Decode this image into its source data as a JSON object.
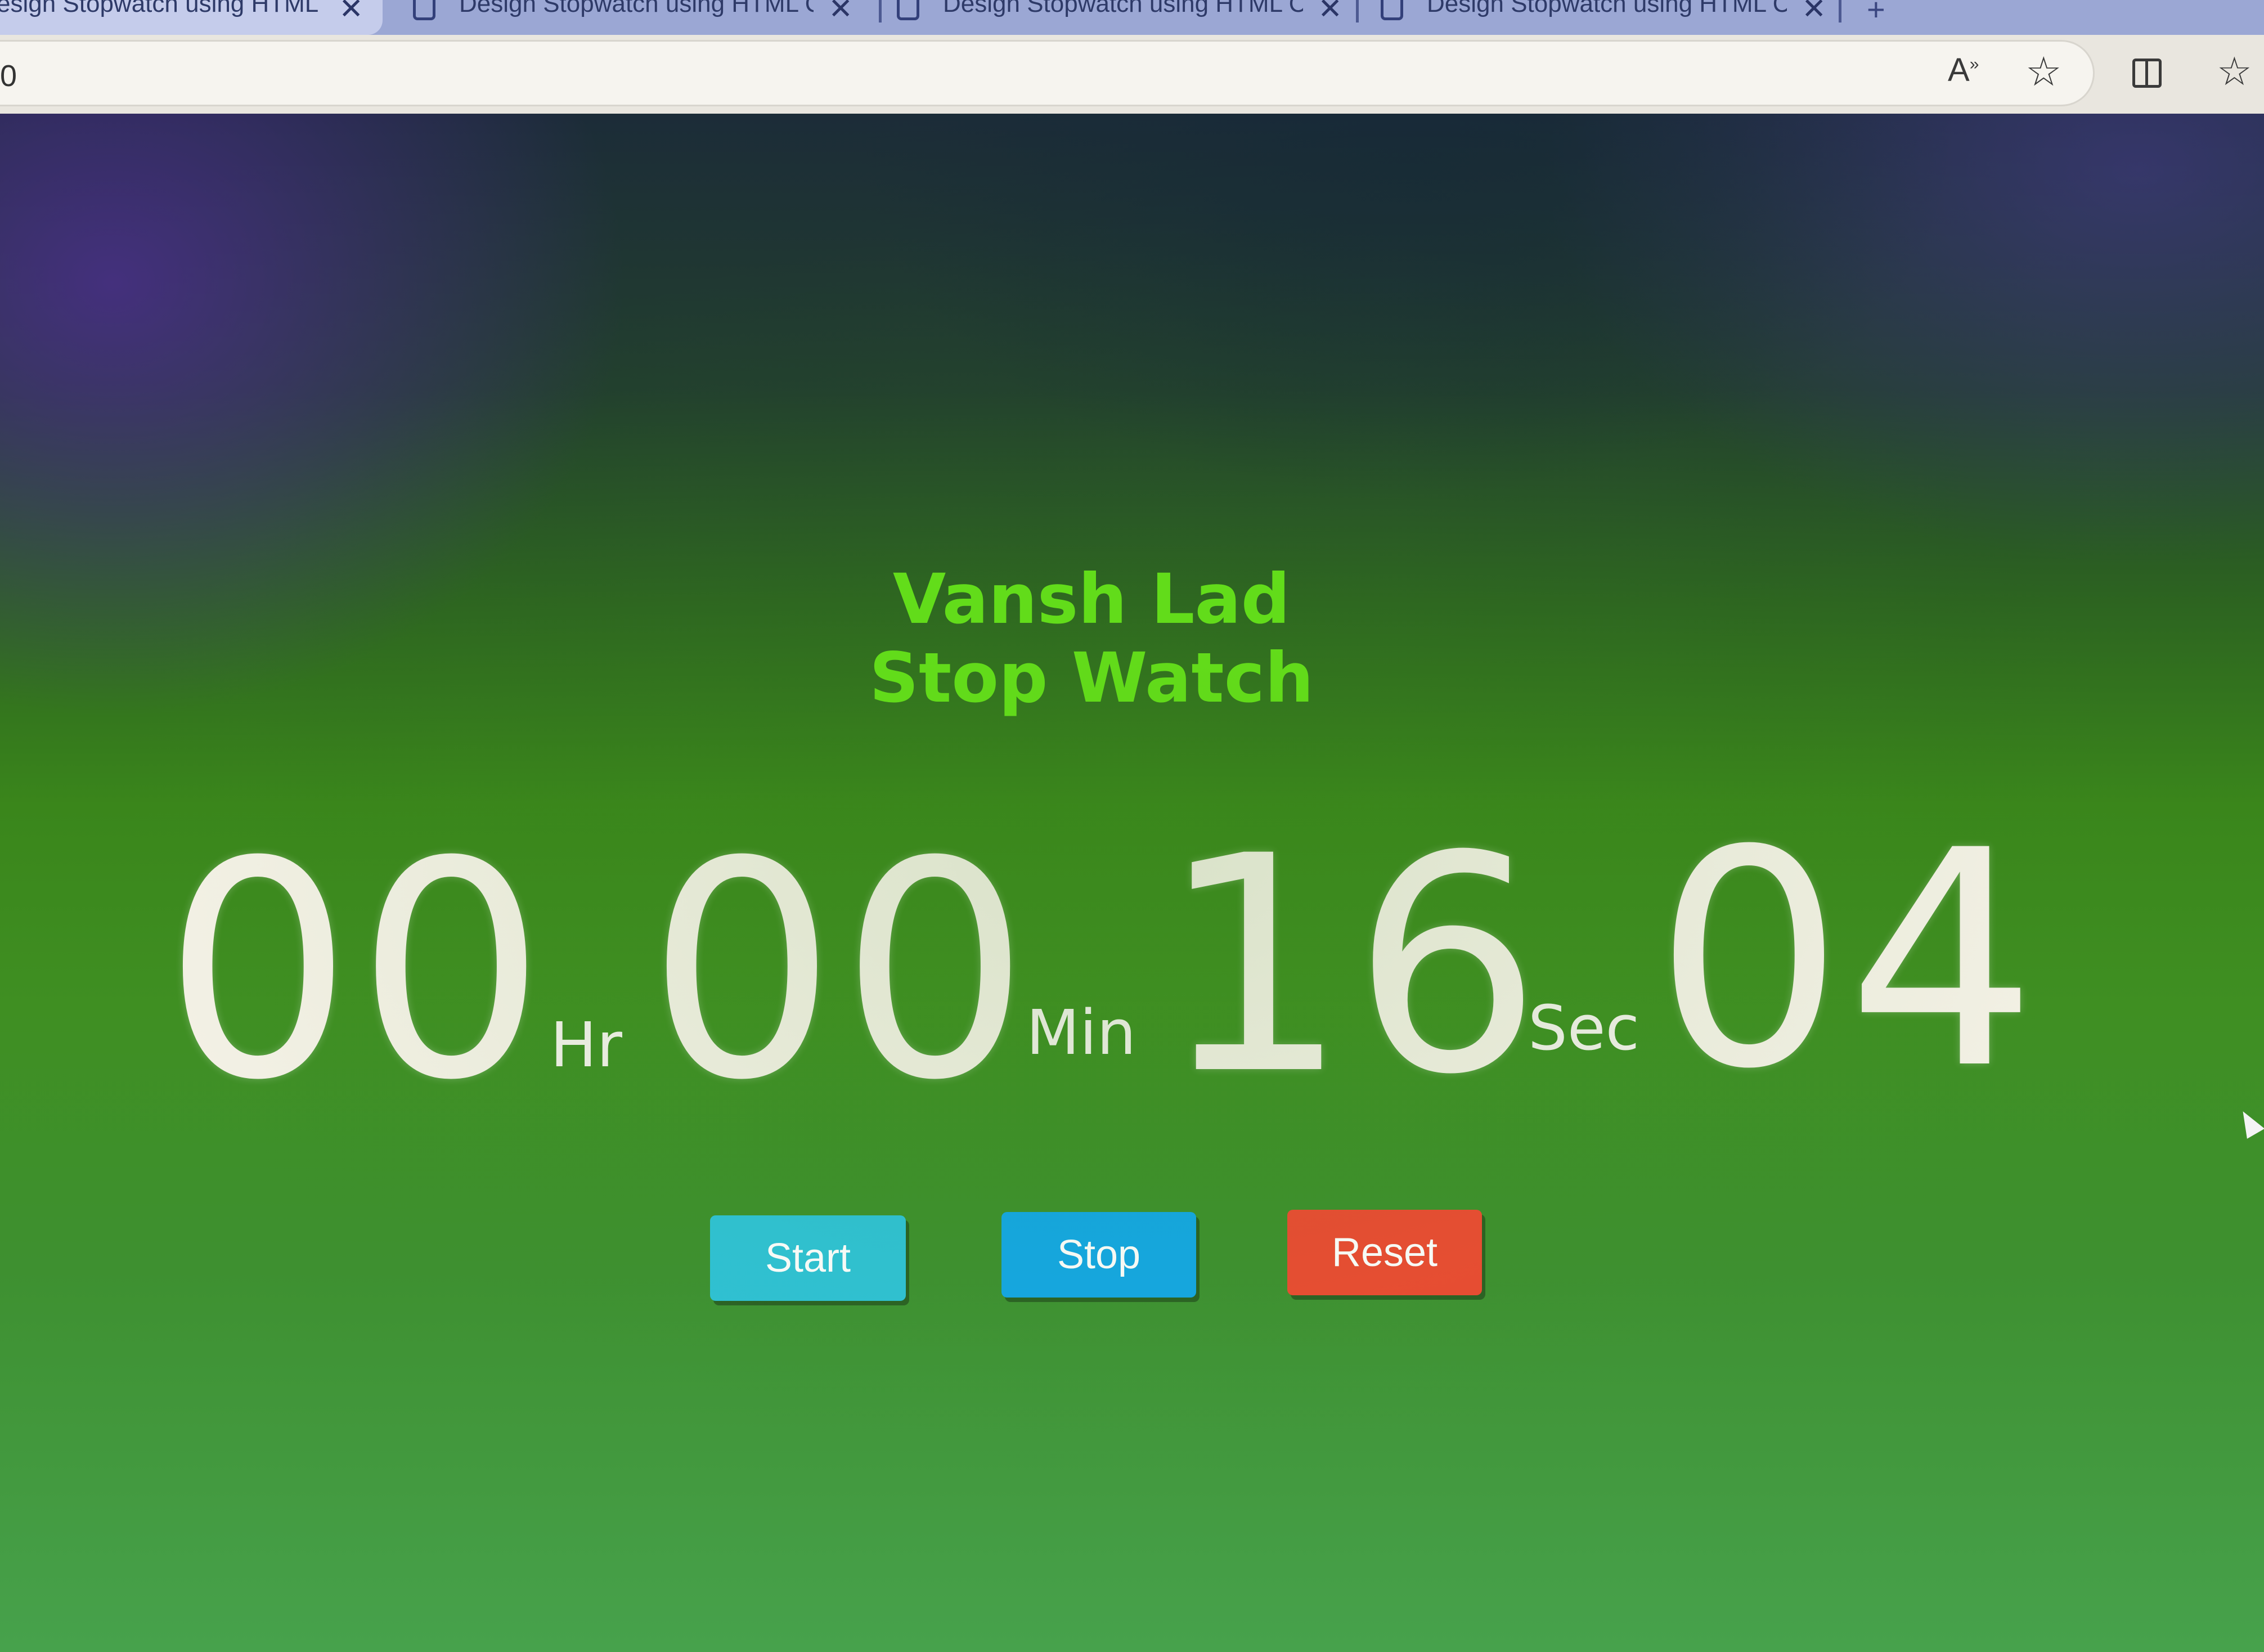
{
  "browser": {
    "tabs": [
      {
        "title": "esign Stopwatch using HTML C",
        "active": true
      },
      {
        "title": "Design Stopwatch using HTML C",
        "active": false
      },
      {
        "title": "Design Stopwatch using HTML C",
        "active": false
      },
      {
        "title": "Design Stopwatch using HTML C",
        "active": false
      }
    ],
    "new_tab_label": "+",
    "address": "0",
    "icons": {
      "read_aloud": "A",
      "read_aloud_sup": "»",
      "favorite": "☆",
      "favorites_bar": "☆"
    }
  },
  "page": {
    "author": "Vansh Lad",
    "title": "Stop Watch",
    "timer": {
      "hours": "00",
      "hours_unit": "Hr",
      "minutes": "00",
      "minutes_unit": "Min",
      "seconds": "16",
      "seconds_unit": "Sec",
      "centiseconds": "04"
    },
    "buttons": {
      "start": "Start",
      "stop": "Stop",
      "reset": "Reset"
    }
  },
  "colors": {
    "heading": "#66e41a",
    "start_button": "#2fc2d6",
    "stop_button": "#14a7e6",
    "reset_button": "#ec4b33",
    "digits": "#f4f1e6"
  }
}
